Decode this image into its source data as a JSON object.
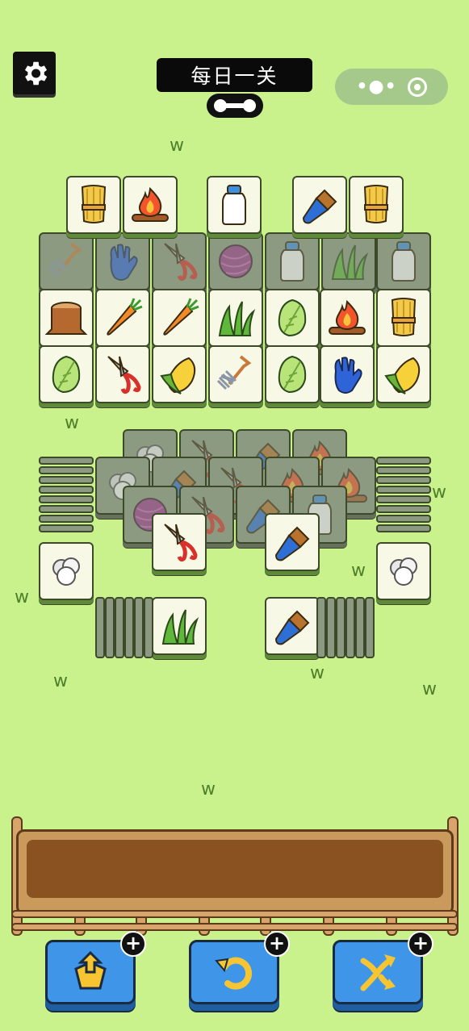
{
  "header": {
    "title": "每日一关",
    "settings_icon": "gear-icon",
    "progress_icon": "dumbbell-icon",
    "menu_capsule_icons": [
      "more-dots-icon",
      "close-target-icon"
    ]
  },
  "tile_icons": {
    "wheat": "wheat-bundle-icon",
    "fire": "campfire-icon",
    "bottle": "milk-bottle-icon",
    "brush": "paint-brush-icon",
    "stump": "tree-stump-icon",
    "carrot": "carrot-icon",
    "grass": "grass-icon",
    "cabbage": "cabbage-icon",
    "shears": "pruning-shears-icon",
    "corn": "corn-icon",
    "fork": "garden-fork-icon",
    "glove": "blue-glove-icon",
    "yarn": "yarn-ball-icon",
    "wool": "cotton-icon"
  },
  "colors": {
    "background": "#c9f28d",
    "tile_face": "#f7f8e6",
    "tile_blocked": "#8c9a82",
    "button": "#3f95e8",
    "tray_soil": "#8a5220"
  },
  "tray": {
    "slots_filled": 0
  },
  "tools": [
    {
      "name": "move-out",
      "icon": "box-out-icon"
    },
    {
      "name": "undo",
      "icon": "undo-arrow-icon"
    },
    {
      "name": "shuffle",
      "icon": "shuffle-arrows-icon"
    }
  ]
}
